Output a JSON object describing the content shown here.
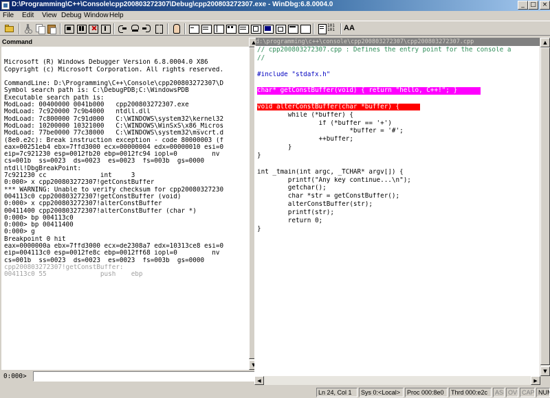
{
  "window": {
    "title": "D:\\Programming\\C++\\Console\\cpp200803272307\\Debug\\cpp200803272307.exe - WinDbg:6.8.0004.0"
  },
  "menu": {
    "file": "File",
    "edit": "Edit",
    "view": "View",
    "debug": "Debug",
    "window": "Window",
    "help": "Help"
  },
  "command_window": {
    "title": "Command",
    "prompt": "0:000>",
    "input_value": "",
    "lines": [
      "",
      "Microsoft (R) Windows Debugger Version 6.8.0004.0 X86",
      "Copyright (c) Microsoft Corporation. All rights reserved.",
      "",
      "CommandLine: D:\\Programming\\C++\\Console\\cpp200803272307\\D",
      "Symbol search path is: C:\\DebugPDB;C:\\WindowsPDB",
      "Executable search path is:",
      "ModLoad: 00400000 0041b000   cpp200803272307.exe",
      "ModLoad: 7c920000 7c9b4000   ntdll.dll",
      "ModLoad: 7c800000 7c91d000   C:\\WINDOWS\\system32\\kernel32",
      "ModLoad: 10200000 10321000   C:\\WINDOWS\\WinSxS\\x86_Micros",
      "ModLoad: 77be0000 77c38000   C:\\WINDOWS\\system32\\msvcrt.d",
      "(8e0.e2c): Break instruction exception - code 80000003 (f",
      "eax=00251eb4 ebx=7ffd3000 ecx=00000004 edx=00000010 esi=0",
      "eip=7c921230 esp=0012fb20 ebp=0012fc94 iopl=0         nv",
      "cs=001b  ss=0023  ds=0023  es=0023  fs=003b  gs=0000",
      "ntdll!DbgBreakPoint:",
      "7c921230 cc              int     3",
      "0:000> x cpp200803272307!getConstBuffer",
      "*** WARNING: Unable to verify checksum for cpp20080327230",
      "004113c0 cpp200803272307!getConstBuffer (void)",
      "0:000> x cpp200803272307!alterConstBuffer",
      "00411400 cpp200803272307!alterConstBuffer (char *)",
      "0:000> bp 004113c0",
      "0:000> bp 00411400",
      "0:000> g",
      "Breakpoint 0 hit",
      "eax=0000000a ebx=7ffd3000 ecx=de2308a7 edx=10313ce8 esi=0",
      "eip=004113c0 esp=0012fe8c ebp=0012ff68 iopl=0         nv",
      "cs=001b  ss=0023  ds=0023  es=0023  fs=003b  gs=0000",
      "cpp200803272307!getConstBuffer:",
      "004113c0 55              push    ebp"
    ]
  },
  "source_window": {
    "path": "d:\\programming\\c++\\console\\cpp200803272307\\cpp200803272307.cpp",
    "lines": [
      "// cpp200803272307.cpp : Defines the entry point for the console a",
      "//",
      "",
      "#include \"stdafx.h\"",
      "",
      "char* getConstBuffer(void) { return \"hello, C++!\"; }",
      "",
      "void alterConstBuffer(char *buffer) {",
      "        while (*buffer) {",
      "                if (*buffer == '+')",
      "                        *buffer = '#';",
      "                ++buffer;",
      "        }",
      "}",
      "",
      "int _tmain(int argc, _TCHAR* argv[]) {",
      "        printf(\"Any key continue...\\n\");",
      "        getchar();",
      "        char *str = getConstBuffer();",
      "        alterConstBuffer(str);",
      "        printf(str);",
      "        return 0;",
      "}"
    ]
  },
  "status": {
    "position": "Ln 24, Col 1",
    "sys": "Sys 0:<Local>",
    "proc": "Proc 000:8e0",
    "thrd": "Thrd 000:e2c",
    "asm": "ASM",
    "ovr": "OVR",
    "caps": "CAPS",
    "num": "NUM"
  },
  "toolbar": {
    "icons": [
      "open-icon",
      "cut-icon",
      "copy-icon",
      "paste-icon",
      "go-icon",
      "restart-icon",
      "stop-debugging-icon",
      "break-icon",
      "step-into-icon",
      "step-over-icon",
      "step-out-icon",
      "run-to-cursor-icon",
      "breakpoint-icon",
      "command-window-icon",
      "watch-window-icon",
      "locals-window-icon",
      "registers-window-icon",
      "memory-window-icon",
      "call-stack-icon",
      "disassembly-icon",
      "scratch-pad-icon",
      "source-mode-icon",
      "hex-mode-icon",
      "font-icon"
    ],
    "hex_label": "101 101",
    "font_label": "AA"
  }
}
